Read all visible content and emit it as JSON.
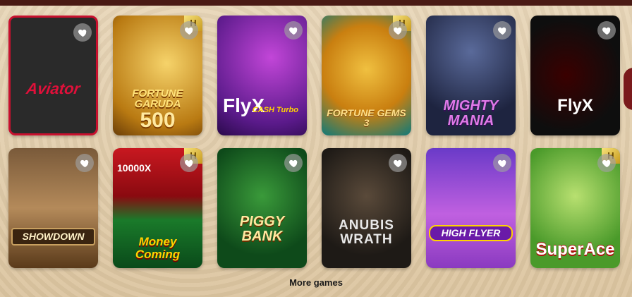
{
  "games": [
    {
      "id": "aviator",
      "title": "Aviator",
      "badge": ""
    },
    {
      "id": "fortune-garuda",
      "title": "FORTUNE GARUDA",
      "big": "500",
      "badge": "H"
    },
    {
      "id": "flyx-cash",
      "title": "FlyX",
      "sub": "CASH Turbo",
      "badge": ""
    },
    {
      "id": "fortune-gems",
      "title": "FORTUNE GEMS 3",
      "badge": "H"
    },
    {
      "id": "mighty-mania",
      "title": "MIGHTY MANIA",
      "badge": ""
    },
    {
      "id": "flyx",
      "title": "FlyX",
      "badge": ""
    },
    {
      "id": "showdown",
      "title": "SHOWDOWN",
      "badge": ""
    },
    {
      "id": "money-coming",
      "title": "Money Coming",
      "top": "10000X",
      "badge": "H"
    },
    {
      "id": "piggy-bank",
      "title": "PIGGY BANK",
      "badge": ""
    },
    {
      "id": "anubis-wrath",
      "title": "ANUBIS WRATH",
      "badge": ""
    },
    {
      "id": "high-flyer",
      "title": "HIGH FLYER",
      "badge": ""
    },
    {
      "id": "super-ace",
      "title": "SuperAce",
      "badge": "H"
    }
  ],
  "more_label": "More games",
  "icons": {
    "favorite": "heart-icon"
  },
  "colors": {
    "background": "#e6d3b3",
    "topbar": "#4a1a14"
  }
}
